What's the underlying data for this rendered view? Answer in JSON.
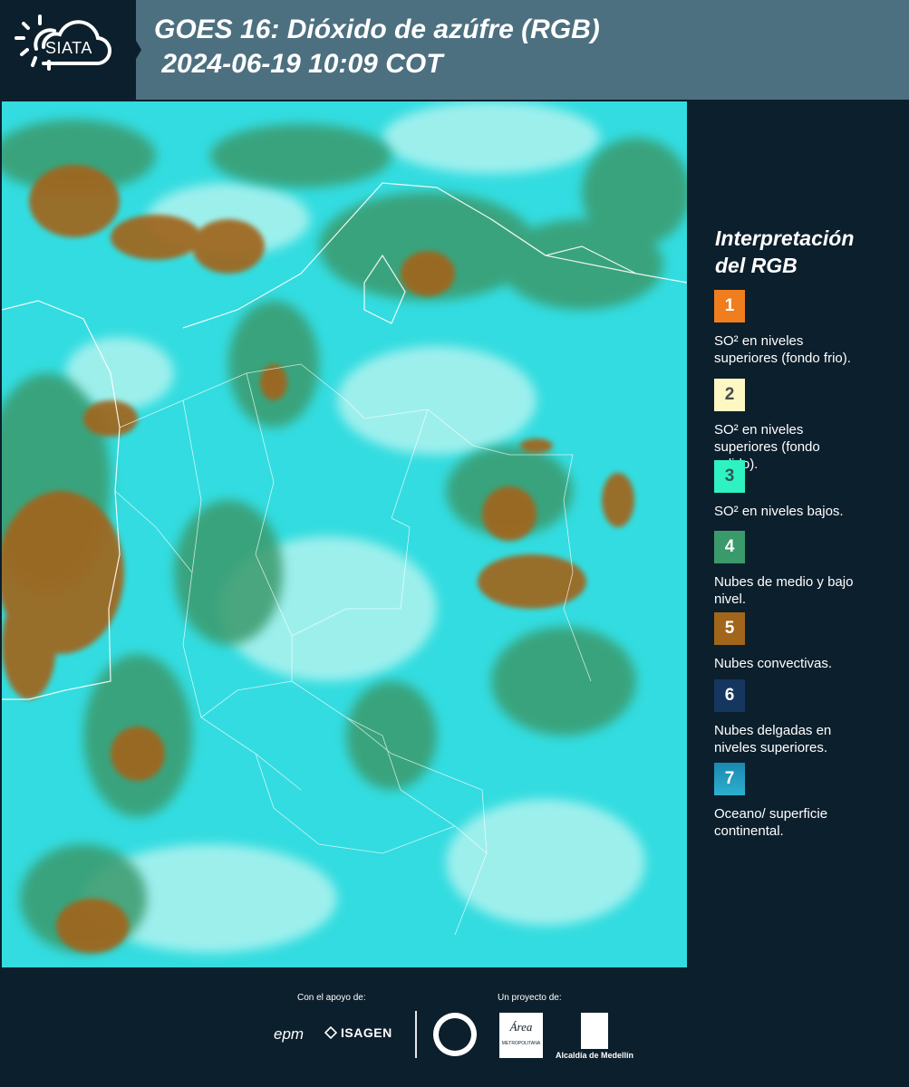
{
  "header": {
    "logo_text": "SIATA",
    "title": "GOES 16: Dióxido de azúfre (RGB)\n 2024-06-19 10:09 COT"
  },
  "legend": {
    "title": "Interpretación\ndel RGB",
    "items": [
      {
        "number": "1",
        "color": "#f07e1e",
        "label": "SO² en niveles\nsuperiores (fondo frio)."
      },
      {
        "number": "2",
        "color": "#fdf7c3",
        "label": "SO² en niveles\nsuperiores (fondo\ncalido)."
      },
      {
        "number": "3",
        "color": "#2ff2c2",
        "label": "SO² en niveles bajos."
      },
      {
        "number": "4",
        "color": "#3a9a6c",
        "label": "Nubes de medio y bajo\nnivel."
      },
      {
        "number": "5",
        "color": "#a1651b",
        "label": "Nubes convectivas."
      },
      {
        "number": "6",
        "color": "#15365f",
        "label": "Nubes delgadas en\nniveles superiores."
      },
      {
        "number": "7",
        "color": "#1b88b0",
        "label": "Oceano/ superficie\ncontinental."
      }
    ]
  },
  "footer": {
    "support_label": "Con el apoyo de:",
    "project_label": "Un proyecto de:",
    "sponsors": [
      "epm",
      "ISAGEN"
    ],
    "partners": [
      "Área Metropolitana Valle de Aburrá",
      "Alcaldía de Medellín"
    ],
    "area_text": "Área",
    "area_sub": "METROPOLITANA",
    "alcaldia_label": "Alcaldía de Medellín"
  },
  "colors": {
    "background": "#0c1f2c",
    "header_band": "#4c7080",
    "ocean_surface": "#33dce0",
    "low_clouds": "#3a9a6c",
    "convective_clouds": "#a1651b"
  }
}
